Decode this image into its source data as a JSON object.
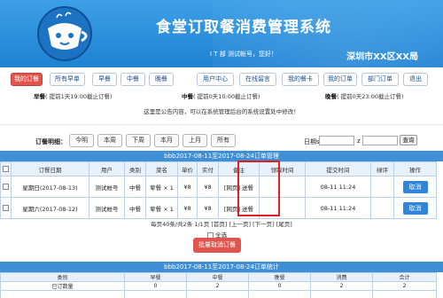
{
  "header": {
    "title": "食堂订取餐消费管理系统",
    "welcome": "I T 部 测试帐号，您好！",
    "region": "深圳市XX区XX局",
    "logo_icon": "tea-cup-logo-icon"
  },
  "nav": {
    "items": [
      "我的订餐",
      "所有早单",
      "早餐",
      "中餐",
      "晚餐",
      "用户中心",
      "在线留言",
      "我的餐卡",
      "我的订单",
      "部门订单"
    ],
    "logout": "退出"
  },
  "deadlines": {
    "breakfast": {
      "label": "早餐",
      "text": "( 提前1天19:00截止订餐)"
    },
    "lunch": {
      "label": "中餐",
      "text": "( 提前0天10:00截止订餐)"
    },
    "dinner": {
      "label": "晚餐",
      "text": "( 提前0天23:00截止订餐)"
    }
  },
  "notice": "这里是公告内容，可以在系统管理后台的系统设置处中修改！",
  "filter": {
    "label": "订餐明细：",
    "buttons": [
      "今明",
      "本周",
      "下周",
      "本月",
      "上月",
      "所有"
    ],
    "date_label": "日期s",
    "date_sep": "z",
    "query": "查询"
  },
  "orders": {
    "title": "bbb2017-08-11至2017-08-24订单管理",
    "columns": [
      "订餐日期",
      "用户",
      "类别",
      "菜名",
      "单价",
      "实付",
      "备注",
      "领取时间",
      "提交时间",
      "绿评",
      "操作"
    ],
    "rows": [
      {
        "date": "星期日(2017-08-13)",
        "user": "测试帐号",
        "type": "中餐",
        "dish": "荤餐 × 1",
        "price": "¥8",
        "paid": "¥8",
        "remark": "[网页] 送餐",
        "pickup": "",
        "submit": "08-11 11:24",
        "review": "",
        "action": "取消"
      },
      {
        "date": "星期六(2017-08-12)",
        "user": "测试帐号",
        "type": "中餐",
        "dish": "荤餐 × 1",
        "price": "¥8",
        "paid": "¥8",
        "remark": "[网页] 送餐",
        "pickup": "",
        "submit": "08-11 11:24",
        "review": "",
        "action": "取消"
      }
    ]
  },
  "pager": "每页40条/共2条 1/1页 [首页] [上一页] [下一页] [尾页]",
  "select_all": "全选",
  "batch_cancel": "批量取消订餐",
  "stats": {
    "title": "bbb2017-08-11至2017-08-24订单统计",
    "columns": [
      "类别",
      "早餐",
      "中餐",
      "晚餐",
      "消费",
      "合计"
    ],
    "rows": [
      [
        "已订数量",
        "0",
        "2",
        "0",
        "2",
        "2"
      ],
      [
        "",
        "",
        "",
        "",
        "",
        ""
      ]
    ]
  },
  "colors": {
    "header": "#1e82d4",
    "active_nav": "#e0554d",
    "button": "#2f86d8",
    "highlight": "#e02020"
  }
}
